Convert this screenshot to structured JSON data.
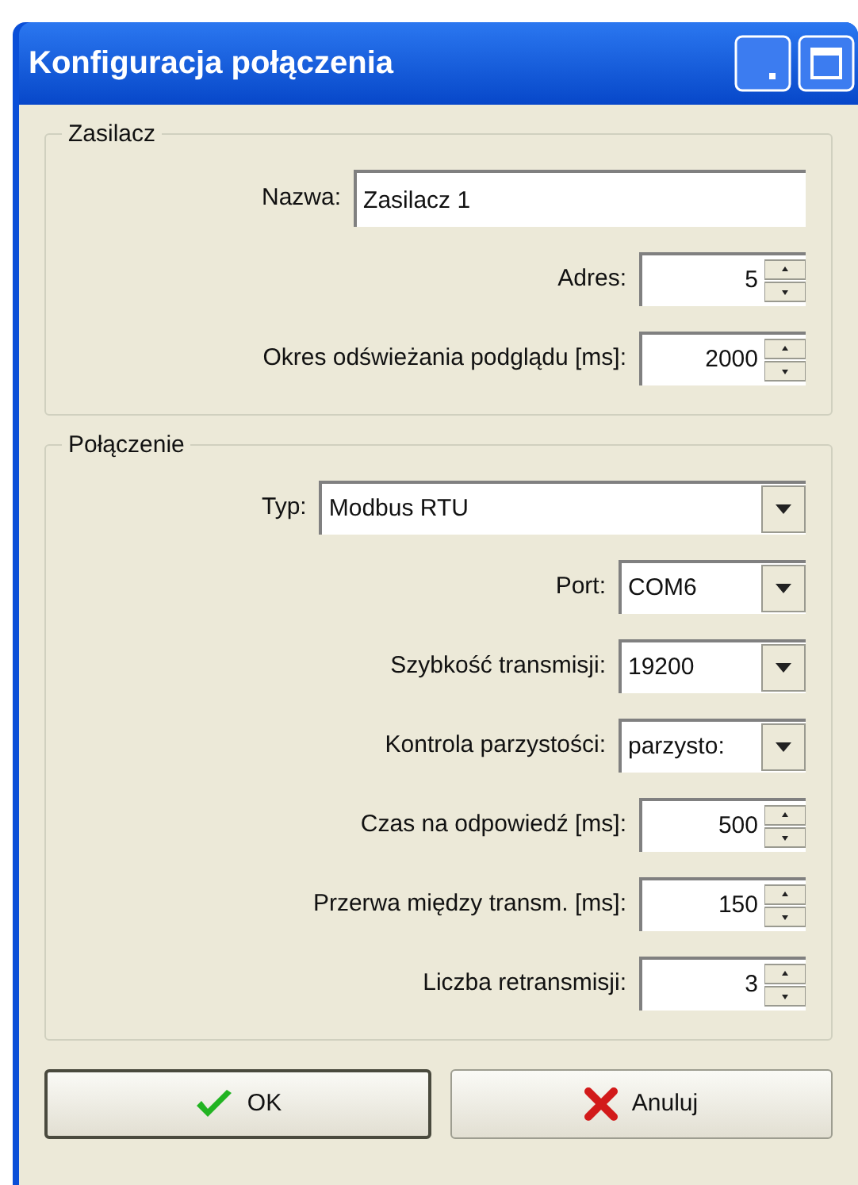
{
  "window": {
    "title": "Konfiguracja połączenia"
  },
  "groups": [
    {
      "title": "Zasilacz",
      "fields": [
        {
          "kind": "text",
          "label": "Nazwa:",
          "value": "Zasilacz 1"
        },
        {
          "kind": "spin",
          "label": "Adres:",
          "value": "5"
        },
        {
          "kind": "spin",
          "label": "Okres odświeżania podglądu [ms]:",
          "value": "2000"
        }
      ]
    },
    {
      "title": "Połączenie",
      "fields": [
        {
          "kind": "combo-wide",
          "label": "Typ:",
          "value": "Modbus RTU"
        },
        {
          "kind": "combo",
          "label": "Port:",
          "value": "COM6"
        },
        {
          "kind": "combo",
          "label": "Szybkość transmisji:",
          "value": "19200"
        },
        {
          "kind": "combo",
          "label": "Kontrola parzystości:",
          "value": "parzysto:"
        },
        {
          "kind": "spin",
          "label": "Czas na odpowiedź [ms]:",
          "value": "500"
        },
        {
          "kind": "spin",
          "label": "Przerwa między transm. [ms]:",
          "value": "150"
        },
        {
          "kind": "spin",
          "label": "Liczba retransmisji:",
          "value": "3"
        }
      ]
    }
  ],
  "buttons": [
    {
      "kind": "ok",
      "label": "OK",
      "default": true
    },
    {
      "kind": "cancel",
      "label": "Anuluj",
      "default": false
    }
  ]
}
